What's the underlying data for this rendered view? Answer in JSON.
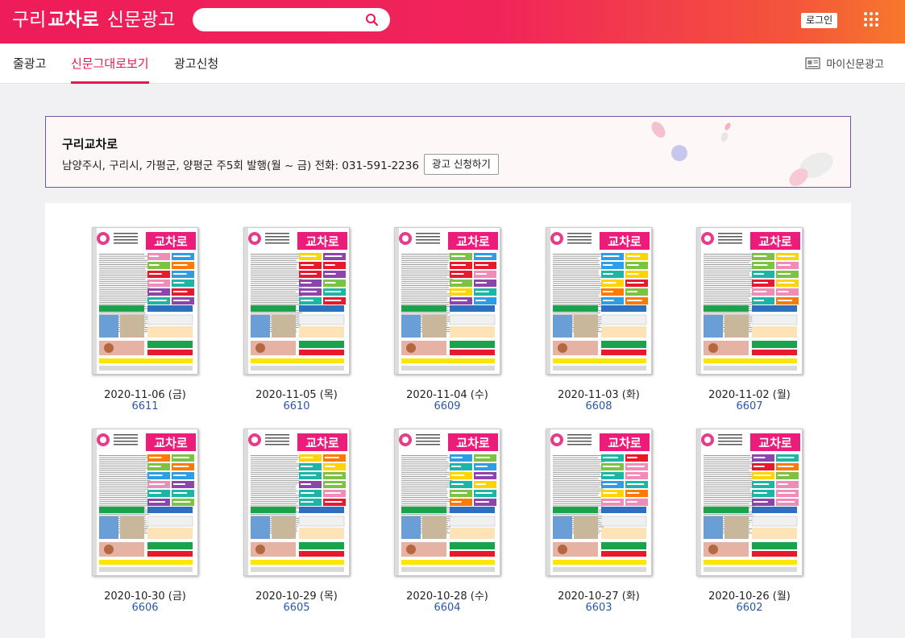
{
  "header": {
    "logo_part1": "구리",
    "logo_part2": "교차로",
    "logo_part3": "신문광고",
    "search_placeholder": "",
    "login_label": "로그인"
  },
  "nav": {
    "tabs": [
      {
        "label": "줄광고"
      },
      {
        "label": "신문그대로보기"
      },
      {
        "label": "광고신청"
      }
    ],
    "my_ads_label": "마이신문광고"
  },
  "banner": {
    "title": "구리교차로",
    "description": "남양주시, 구리시, 가평군, 양평군 주5회 발행(월 ~ 금) 전화: 031-591-2236",
    "button_label": "광고 신청하기"
  },
  "issues": [
    {
      "date": "2020-11-06 (금)",
      "number": "6611"
    },
    {
      "date": "2020-11-05 (목)",
      "number": "6610"
    },
    {
      "date": "2020-11-04 (수)",
      "number": "6609"
    },
    {
      "date": "2020-11-03 (화)",
      "number": "6608"
    },
    {
      "date": "2020-11-02 (월)",
      "number": "6607"
    },
    {
      "date": "2020-10-30 (금)",
      "number": "6606"
    },
    {
      "date": "2020-10-29 (목)",
      "number": "6605"
    },
    {
      "date": "2020-10-28 (수)",
      "number": "6604"
    },
    {
      "date": "2020-10-27 (화)",
      "number": "6603"
    },
    {
      "date": "2020-10-26 (월)",
      "number": "6602"
    }
  ],
  "thumbnail_masthead": "교차로",
  "colors": {
    "brand_pink": "#ee1c59",
    "brand_orange": "#f7782c",
    "active_tab": "#e8174f",
    "issue_number": "#2a57a3",
    "banner_border": "#6b5a97"
  }
}
